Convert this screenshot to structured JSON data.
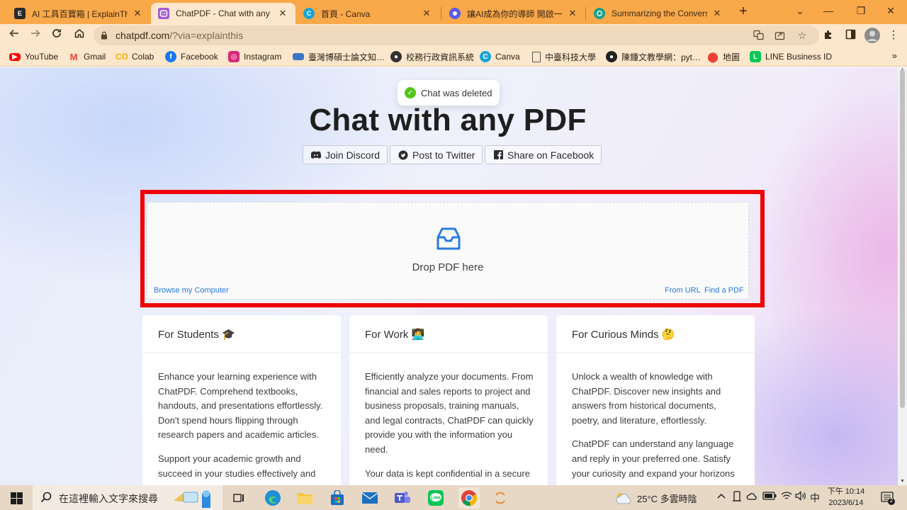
{
  "browser": {
    "tabs": [
      {
        "title": "AI 工具百寶箱 | ExplainThis",
        "icon": "explainthis-icon",
        "favicon_letter": "E",
        "color": "#2b2b2b"
      },
      {
        "title": "ChatPDF - Chat with any PDF",
        "icon": "chatpdf-icon",
        "favicon_letter": "",
        "color": "#a35bd3"
      },
      {
        "title": "首頁 - Canva",
        "icon": "canva-icon",
        "favicon_letter": "C",
        "color": "#1aa3d6"
      },
      {
        "title": "讓AI成為你的導師 開啟一場…",
        "icon": "ai-tutor-icon",
        "favicon_letter": "",
        "color": "#5b5be8"
      },
      {
        "title": "Summarizing the Conversat…",
        "icon": "summarize-icon",
        "favicon_letter": "",
        "color": "#19a08a"
      }
    ],
    "active_tab_index": 1,
    "new_tab_label": "+",
    "window_controls": {
      "dropdown": "⌄",
      "minimize": "—",
      "restore": "❐",
      "close": "✕"
    },
    "address": {
      "domain": "chatpdf.com",
      "path": "/?via=explainthis"
    },
    "bookmarks": [
      {
        "label": "YouTube",
        "icon": "youtube-icon",
        "color": "#ff0000"
      },
      {
        "label": "Gmail",
        "icon": "gmail-icon",
        "color": "#ea4335"
      },
      {
        "label": "Colab",
        "icon": "colab-icon",
        "color": "#f9ab00"
      },
      {
        "label": "Facebook",
        "icon": "facebook-icon",
        "color": "#1877f2"
      },
      {
        "label": "Instagram",
        "icon": "instagram-icon",
        "color": "#d62976"
      },
      {
        "label": "臺灣博碩士論文知…",
        "icon": "thesis-icon",
        "color": "#3b77c7"
      },
      {
        "label": "校務行政資訊系統",
        "icon": "school-admin-icon",
        "color": "#333333"
      },
      {
        "label": "Canva",
        "icon": "canva-icon",
        "color": "#1aa3d6"
      },
      {
        "label": "中臺科技大學",
        "icon": "page-icon",
        "color": "#666666"
      },
      {
        "label": "陳鍾文教學網：pyt…",
        "icon": "github-icon",
        "color": "#222222"
      },
      {
        "label": "地圖",
        "icon": "maps-icon",
        "color": "#34a853"
      },
      {
        "label": "LINE Business ID",
        "icon": "line-icon",
        "color": "#06c755"
      }
    ],
    "bookmarks_more": "»"
  },
  "page": {
    "toast": "Chat was deleted",
    "title": "Chat with any PDF",
    "social_buttons": [
      {
        "label": "Join Discord",
        "icon": "discord-icon"
      },
      {
        "label": "Post to Twitter",
        "icon": "twitter-icon"
      },
      {
        "label": "Share on Facebook",
        "icon": "facebook-icon"
      }
    ],
    "dropzone": {
      "label": "Drop PDF here",
      "browse": "Browse my Computer",
      "from_url": "From URL",
      "find_pdf": "Find a PDF"
    },
    "cards": [
      {
        "title": "For Students 🎓",
        "paragraphs": [
          "Enhance your learning experience with ChatPDF. Comprehend textbooks, handouts, and presentations effortlessly. Don't spend hours flipping through research papers and academic articles.",
          "Support your academic growth and succeed in your studies effectively and"
        ]
      },
      {
        "title": "For Work 👩‍💻",
        "paragraphs": [
          "Efficiently analyze your documents. From financial and sales reports to project and business proposals, training manuals, and legal contracts, ChatPDF can quickly provide you with the information you need.",
          "Your data is kept confidential in a secure"
        ]
      },
      {
        "title": "For Curious Minds 🤔",
        "paragraphs": [
          "Unlock a wealth of knowledge with ChatPDF. Discover new insights and answers from historical documents, poetry, and literature, effortlessly.",
          "ChatPDF can understand any language and reply in your preferred one. Satisfy your curiosity and expand your horizons"
        ]
      }
    ],
    "accent_color": "#2a7ae2",
    "highlight_color": "#f00000"
  },
  "taskbar": {
    "search_placeholder": "在這裡輸入文字來搜尋",
    "weather": "25°C 多雲時陰",
    "ime": "中",
    "time": "下午 10:14",
    "date": "2023/6/14",
    "notification_count": "2"
  }
}
